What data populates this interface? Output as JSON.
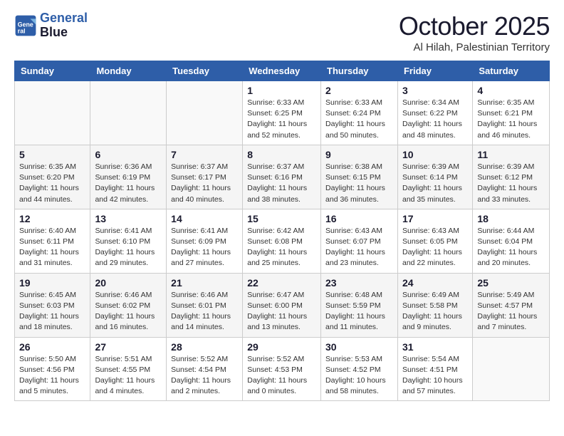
{
  "header": {
    "logo_line1": "General",
    "logo_line2": "Blue",
    "month": "October 2025",
    "location": "Al Hilah, Palestinian Territory"
  },
  "days_of_week": [
    "Sunday",
    "Monday",
    "Tuesday",
    "Wednesday",
    "Thursday",
    "Friday",
    "Saturday"
  ],
  "weeks": [
    [
      {
        "day": "",
        "info": ""
      },
      {
        "day": "",
        "info": ""
      },
      {
        "day": "",
        "info": ""
      },
      {
        "day": "1",
        "info": "Sunrise: 6:33 AM\nSunset: 6:25 PM\nDaylight: 11 hours\nand 52 minutes."
      },
      {
        "day": "2",
        "info": "Sunrise: 6:33 AM\nSunset: 6:24 PM\nDaylight: 11 hours\nand 50 minutes."
      },
      {
        "day": "3",
        "info": "Sunrise: 6:34 AM\nSunset: 6:22 PM\nDaylight: 11 hours\nand 48 minutes."
      },
      {
        "day": "4",
        "info": "Sunrise: 6:35 AM\nSunset: 6:21 PM\nDaylight: 11 hours\nand 46 minutes."
      }
    ],
    [
      {
        "day": "5",
        "info": "Sunrise: 6:35 AM\nSunset: 6:20 PM\nDaylight: 11 hours\nand 44 minutes."
      },
      {
        "day": "6",
        "info": "Sunrise: 6:36 AM\nSunset: 6:19 PM\nDaylight: 11 hours\nand 42 minutes."
      },
      {
        "day": "7",
        "info": "Sunrise: 6:37 AM\nSunset: 6:17 PM\nDaylight: 11 hours\nand 40 minutes."
      },
      {
        "day": "8",
        "info": "Sunrise: 6:37 AM\nSunset: 6:16 PM\nDaylight: 11 hours\nand 38 minutes."
      },
      {
        "day": "9",
        "info": "Sunrise: 6:38 AM\nSunset: 6:15 PM\nDaylight: 11 hours\nand 36 minutes."
      },
      {
        "day": "10",
        "info": "Sunrise: 6:39 AM\nSunset: 6:14 PM\nDaylight: 11 hours\nand 35 minutes."
      },
      {
        "day": "11",
        "info": "Sunrise: 6:39 AM\nSunset: 6:12 PM\nDaylight: 11 hours\nand 33 minutes."
      }
    ],
    [
      {
        "day": "12",
        "info": "Sunrise: 6:40 AM\nSunset: 6:11 PM\nDaylight: 11 hours\nand 31 minutes."
      },
      {
        "day": "13",
        "info": "Sunrise: 6:41 AM\nSunset: 6:10 PM\nDaylight: 11 hours\nand 29 minutes."
      },
      {
        "day": "14",
        "info": "Sunrise: 6:41 AM\nSunset: 6:09 PM\nDaylight: 11 hours\nand 27 minutes."
      },
      {
        "day": "15",
        "info": "Sunrise: 6:42 AM\nSunset: 6:08 PM\nDaylight: 11 hours\nand 25 minutes."
      },
      {
        "day": "16",
        "info": "Sunrise: 6:43 AM\nSunset: 6:07 PM\nDaylight: 11 hours\nand 23 minutes."
      },
      {
        "day": "17",
        "info": "Sunrise: 6:43 AM\nSunset: 6:05 PM\nDaylight: 11 hours\nand 22 minutes."
      },
      {
        "day": "18",
        "info": "Sunrise: 6:44 AM\nSunset: 6:04 PM\nDaylight: 11 hours\nand 20 minutes."
      }
    ],
    [
      {
        "day": "19",
        "info": "Sunrise: 6:45 AM\nSunset: 6:03 PM\nDaylight: 11 hours\nand 18 minutes."
      },
      {
        "day": "20",
        "info": "Sunrise: 6:46 AM\nSunset: 6:02 PM\nDaylight: 11 hours\nand 16 minutes."
      },
      {
        "day": "21",
        "info": "Sunrise: 6:46 AM\nSunset: 6:01 PM\nDaylight: 11 hours\nand 14 minutes."
      },
      {
        "day": "22",
        "info": "Sunrise: 6:47 AM\nSunset: 6:00 PM\nDaylight: 11 hours\nand 13 minutes."
      },
      {
        "day": "23",
        "info": "Sunrise: 6:48 AM\nSunset: 5:59 PM\nDaylight: 11 hours\nand 11 minutes."
      },
      {
        "day": "24",
        "info": "Sunrise: 6:49 AM\nSunset: 5:58 PM\nDaylight: 11 hours\nand 9 minutes."
      },
      {
        "day": "25",
        "info": "Sunrise: 5:49 AM\nSunset: 4:57 PM\nDaylight: 11 hours\nand 7 minutes."
      }
    ],
    [
      {
        "day": "26",
        "info": "Sunrise: 5:50 AM\nSunset: 4:56 PM\nDaylight: 11 hours\nand 5 minutes."
      },
      {
        "day": "27",
        "info": "Sunrise: 5:51 AM\nSunset: 4:55 PM\nDaylight: 11 hours\nand 4 minutes."
      },
      {
        "day": "28",
        "info": "Sunrise: 5:52 AM\nSunset: 4:54 PM\nDaylight: 11 hours\nand 2 minutes."
      },
      {
        "day": "29",
        "info": "Sunrise: 5:52 AM\nSunset: 4:53 PM\nDaylight: 11 hours\nand 0 minutes."
      },
      {
        "day": "30",
        "info": "Sunrise: 5:53 AM\nSunset: 4:52 PM\nDaylight: 10 hours\nand 58 minutes."
      },
      {
        "day": "31",
        "info": "Sunrise: 5:54 AM\nSunset: 4:51 PM\nDaylight: 10 hours\nand 57 minutes."
      },
      {
        "day": "",
        "info": ""
      }
    ]
  ]
}
